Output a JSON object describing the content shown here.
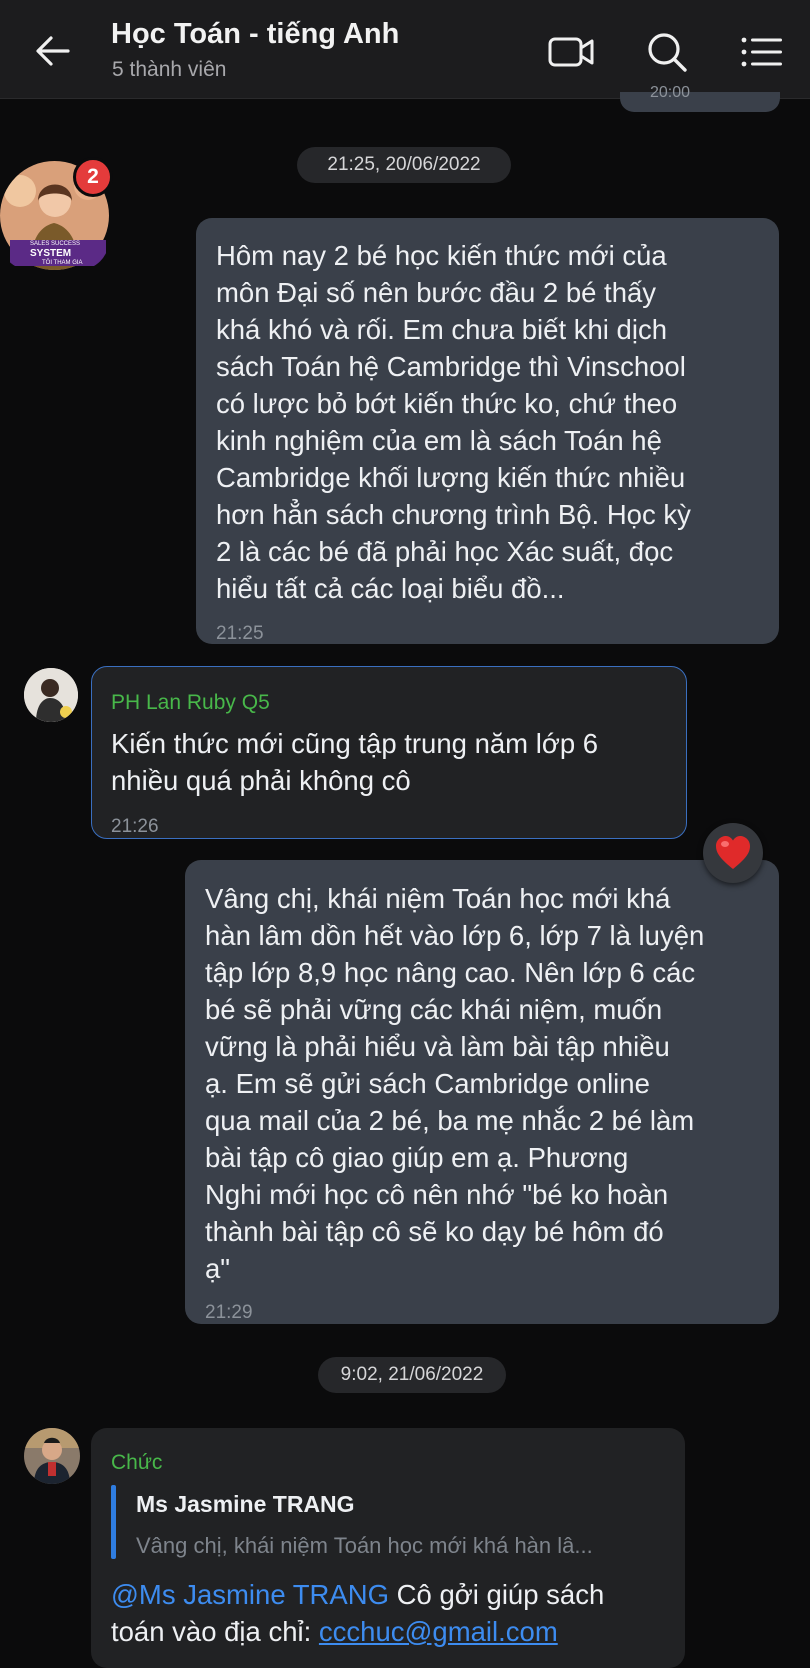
{
  "header": {
    "title": "Học Toán - tiếng Anh",
    "subtitle": "5 thành viên",
    "icons": [
      "back-arrow-icon",
      "video-call-icon",
      "search-icon",
      "menu-list-icon"
    ]
  },
  "peek_time": "20:00",
  "timestamps": [
    "21:25, 20/06/2022",
    "9:02, 21/06/2022"
  ],
  "avatar_badge": "2",
  "avatar_banner": {
    "line1": "SALES SUCCESS",
    "line2": "SYSTEM",
    "line3": "TÔI THAM GIA"
  },
  "messages": [
    {
      "type": "outgoing",
      "lines": [
        "Hôm nay 2 bé học kiến thức mới của",
        "môn Đại số nên bước đầu 2 bé thấy",
        "khá khó và rối. Em chưa biết khi dịch",
        "sách Toán hệ Cambridge thì Vinschool",
        "có lược bỏ bớt kiến thức ko, chứ theo",
        "kinh nghiệm của em là sách Toán hệ",
        "Cambridge khối lượng kiến thức nhiều",
        "hơn hẳn sách chương trình Bộ. Học kỳ",
        "2 là các bé đã phải học Xác suất, đọc",
        "hiểu tất cả các loại biểu đồ..."
      ],
      "time": "21:25"
    },
    {
      "type": "incoming",
      "sender": "PH Lan Ruby Q5",
      "lines": [
        "Kiến thức mới cũng tập trung năm lớp 6",
        "nhiều quá phải không cô"
      ],
      "time": "21:26"
    },
    {
      "type": "outgoing",
      "reaction": "heart-reaction-icon",
      "lines": [
        "Vâng chị, khái niệm Toán học mới khá",
        "hàn lâm dồn hết vào lớp 6, lớp 7 là luyện",
        "tập lớp 8,9 học nâng cao. Nên lớp 6 các",
        "bé sẽ phải vững các khái niệm, muốn",
        "vững là phải hiểu và làm bài tập nhiều",
        "ạ.  Em sẽ gửi sách Cambridge online",
        "qua mail của 2 bé, ba mẹ nhắc 2 bé làm",
        "bài tập cô giao giúp em ạ.  Phương",
        "Nghi mới học cô nên nhớ \"bé ko hoàn",
        "thành bài tập cô sẽ ko dạy bé hôm đó",
        "ạ\""
      ],
      "time": "21:29"
    },
    {
      "type": "incoming",
      "sender": "Chức",
      "quote": {
        "name": "Ms Jasmine TRANG",
        "text": "Vâng chị, khái niệm Toán học mới khá hàn lâ..."
      },
      "mention": "@Ms Jasmine TRANG",
      "line1_rest": " Cô gởi giúp sách",
      "line2_prefix": "toán vào địa chỉ: ",
      "email": "ccchuc@gmail.com"
    }
  ]
}
